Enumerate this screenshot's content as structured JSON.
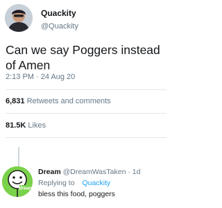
{
  "tweet": {
    "author_name": "Quackity",
    "author_handle": "@Quackity",
    "text": "Can we say Poggers instead of Amen",
    "timestamp": "2:13 PM · 24 Aug 20",
    "retweets": {
      "count": "6,831",
      "label": "Retweets and comments"
    },
    "likes": {
      "count": "81.5K",
      "label": "Likes"
    }
  },
  "reply": {
    "author_name": "Dream",
    "author_handle": "@DreamWasTaken",
    "age": "· 1d",
    "replying_to_label": "Replying to",
    "replying_to_handle": "Quackity",
    "text": "bless this food, poggers",
    "avatar_logo_text": "dream"
  },
  "colors": {
    "link_blue": "#1da1f2",
    "secondary_text": "#657786",
    "dream_green": "#7ad14a"
  }
}
